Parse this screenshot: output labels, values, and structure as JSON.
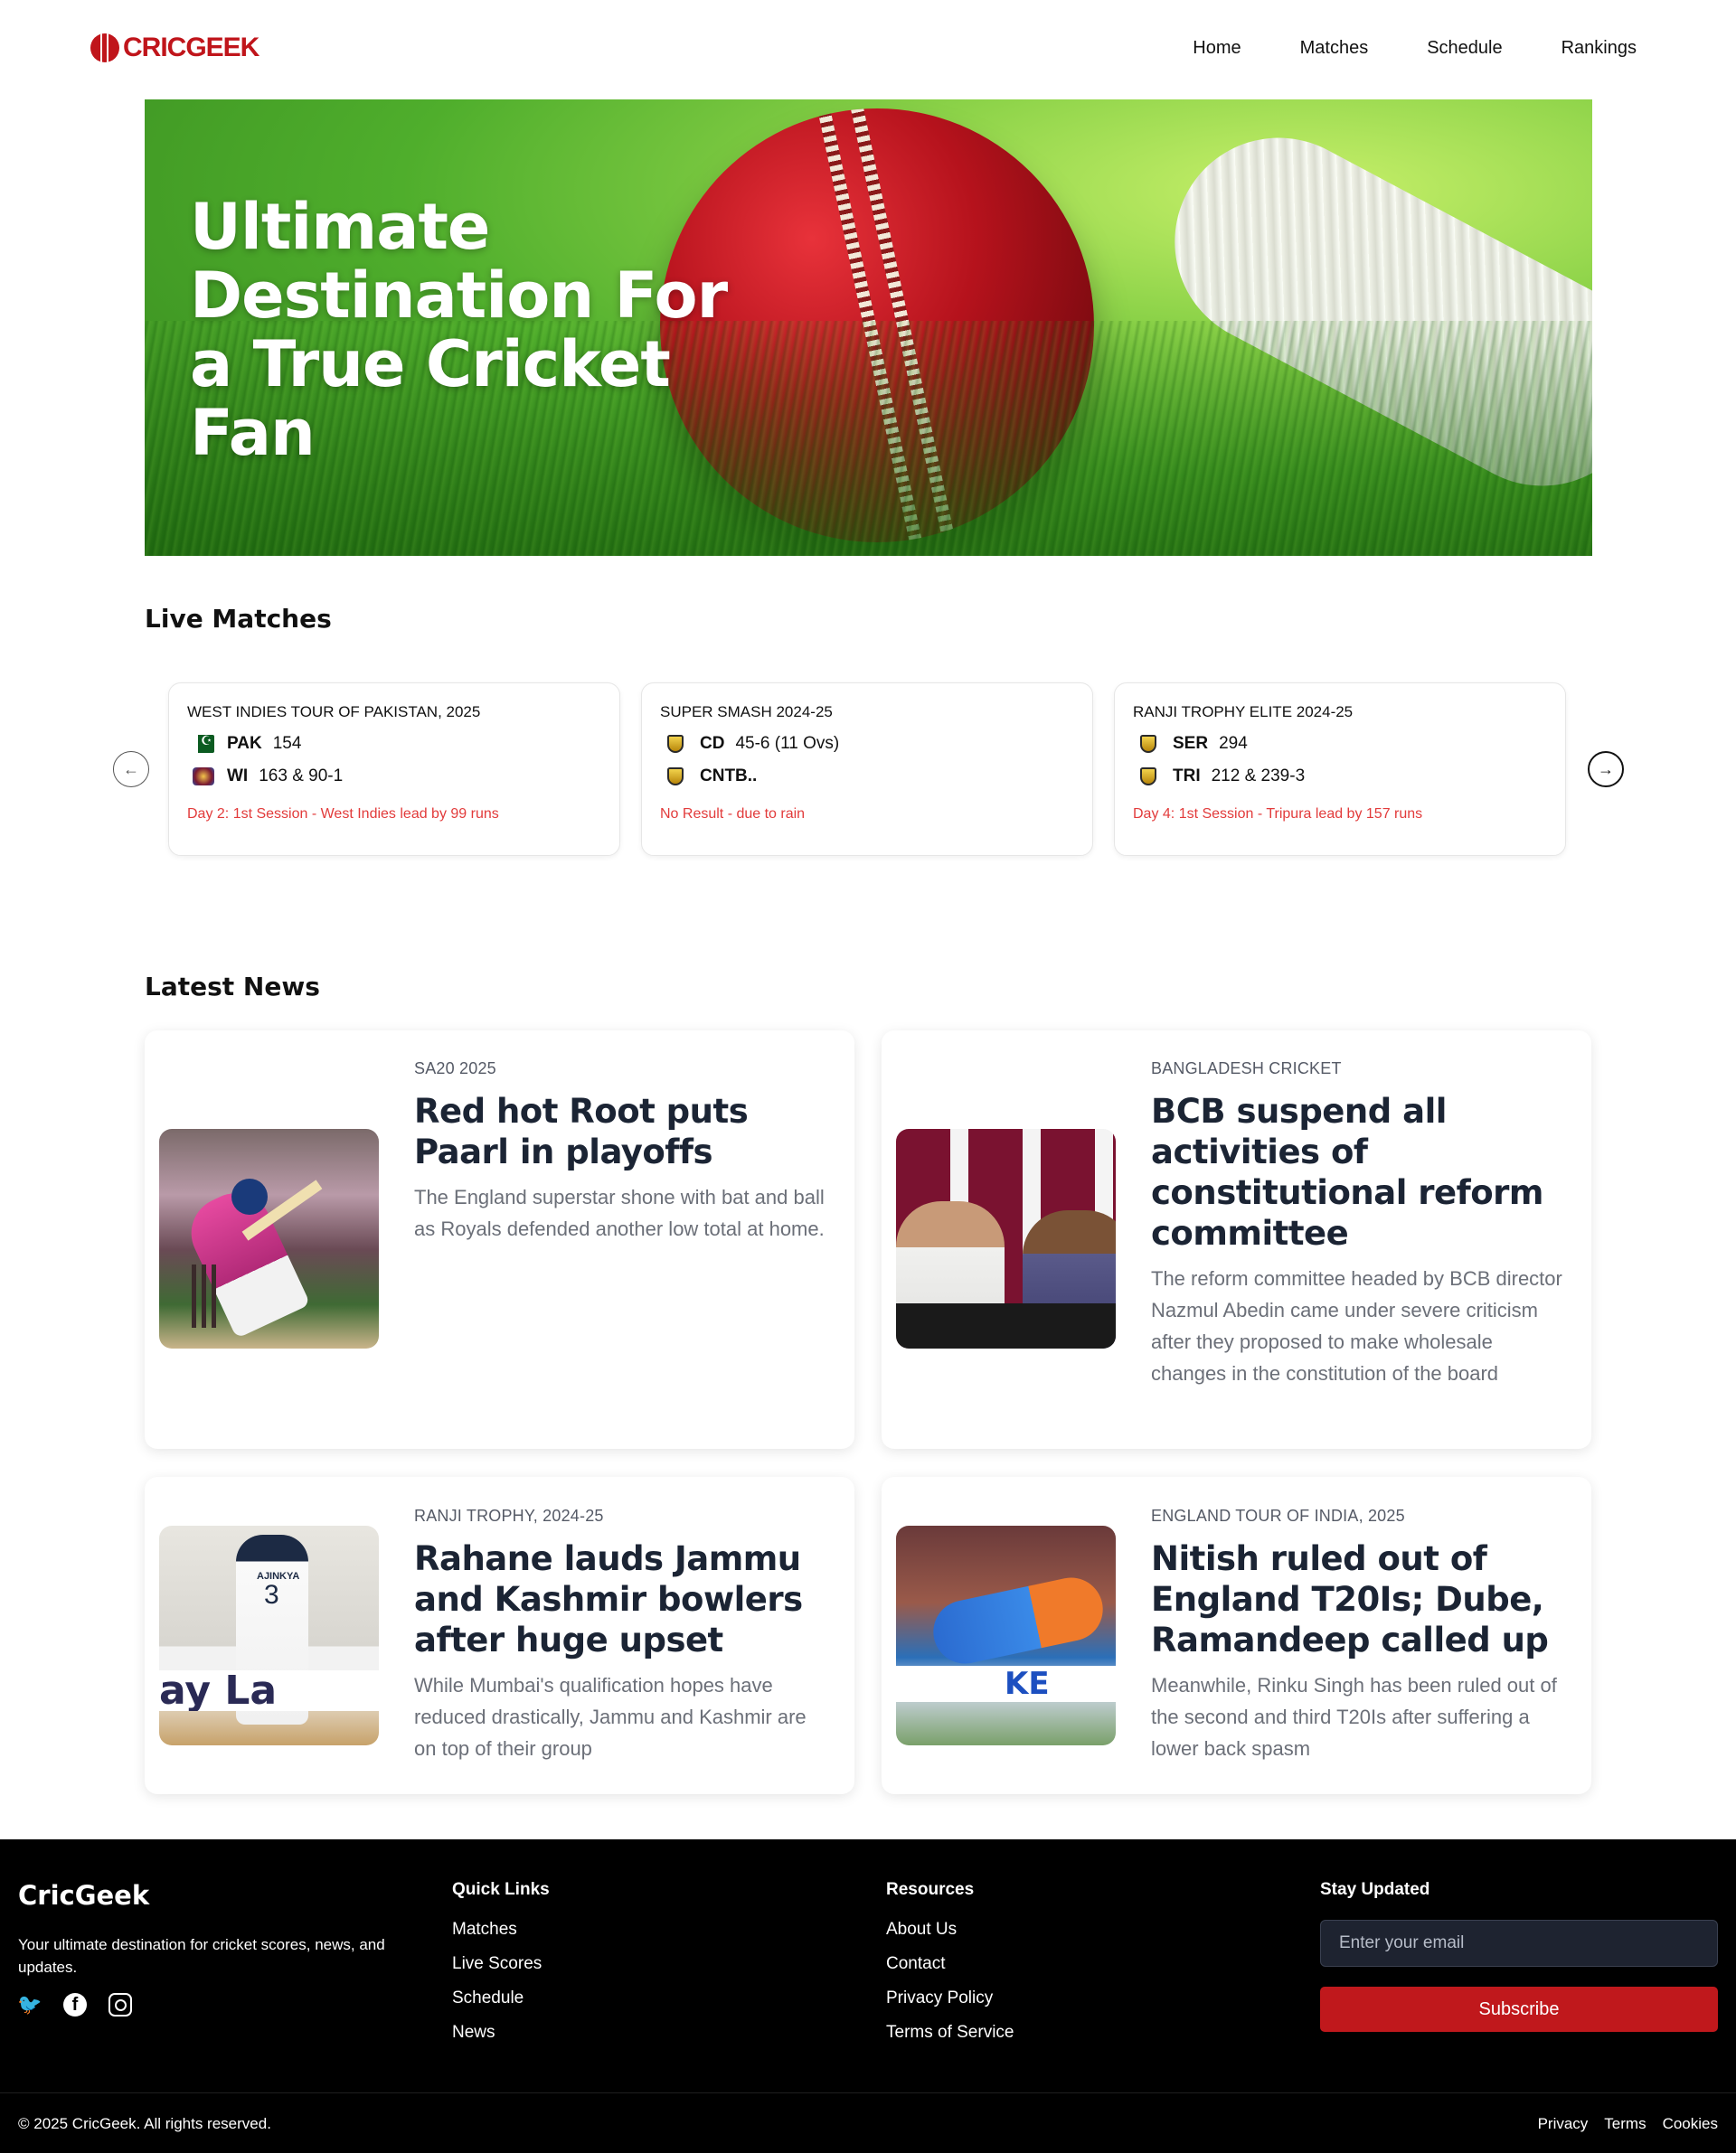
{
  "nav": {
    "logo_text": "CRICGEEK",
    "links": [
      "Home",
      "Matches",
      "Schedule",
      "Rankings"
    ]
  },
  "hero": {
    "title": "Ultimate Destination For a True Cricket Fan"
  },
  "live": {
    "heading": "Live Matches",
    "matches": [
      {
        "series": "WEST INDIES TOUR OF PAKISTAN, 2025",
        "teams": [
          {
            "code": "PAK",
            "score": "154",
            "icon": "pakistan-flag-icon"
          },
          {
            "code": "WI",
            "score": "163 & 90-1",
            "icon": "west-indies-flag-icon"
          }
        ],
        "status": "Day 2: 1st Session - West Indies lead by 99 runs"
      },
      {
        "series": "SUPER SMASH 2024-25",
        "teams": [
          {
            "code": "CD",
            "score": "45-6 (11 Ovs)",
            "icon": "shield-icon"
          },
          {
            "code": "CNTB..",
            "score": "",
            "icon": "shield-icon"
          }
        ],
        "status": "No Result - due to rain"
      },
      {
        "series": "RANJI TROPHY ELITE 2024-25",
        "teams": [
          {
            "code": "SER",
            "score": "294",
            "icon": "shield-icon"
          },
          {
            "code": "TRI",
            "score": "212 & 239-3",
            "icon": "shield-icon"
          }
        ],
        "status": "Day 4: 1st Session - Tripura lead by 157 runs"
      }
    ],
    "status_color": "#e23b3b"
  },
  "news": {
    "heading": "Latest News",
    "items": [
      {
        "category": "SA20 2025",
        "title": "Red hot Root puts Paarl in playoffs",
        "desc": "The England superstar shone with bat and ball as Royals defended another low total at home."
      },
      {
        "category": "BANGLADESH CRICKET",
        "title": "BCB suspend all activities of constitutional reform committee",
        "desc": "The reform committee headed by BCB director Nazmul Abedin came under severe criticism after they proposed to make wholesale changes in the constitution of the board"
      },
      {
        "category": "RANJI TROPHY, 2024-25",
        "title": "Rahane lauds Jammu and Kashmir bowlers after huge upset",
        "desc": "While Mumbai's qualification hopes have reduced drastically, Jammu and Kashmir are on top of their group"
      },
      {
        "category": "ENGLAND TOUR OF INDIA, 2025",
        "title": "Nitish ruled out of England T20Is; Dube, Ramandeep called up",
        "desc": "Meanwhile, Rinku Singh has been ruled out of the second and third T20Is after suffering a lower back spasm"
      }
    ],
    "image_text": {
      "rahane_jersey": "AJINKYA",
      "rahane_number": "3",
      "rahane_ad": "ay La",
      "nitish_banner": "KE"
    }
  },
  "footer": {
    "brand": "CricGeek",
    "tagline": "Your ultimate destination for cricket scores, news, and updates.",
    "social": [
      "twitter-icon",
      "facebook-icon",
      "instagram-icon"
    ],
    "quick_links": {
      "heading": "Quick Links",
      "items": [
        "Matches",
        "Live Scores",
        "Schedule",
        "News"
      ]
    },
    "resources": {
      "heading": "Resources",
      "items": [
        "About Us",
        "Contact",
        "Privacy Policy",
        "Terms of Service"
      ]
    },
    "newsletter": {
      "heading": "Stay Updated",
      "placeholder": "Enter your email",
      "button": "Subscribe"
    },
    "copyright": "© 2025 CricGeek. All rights reserved.",
    "bottom_links": [
      "Privacy",
      "Terms",
      "Cookies"
    ]
  },
  "colors": {
    "brand_red": "#c0151b",
    "subscribe_red": "#c0181c",
    "footer_bg": "#000000"
  }
}
